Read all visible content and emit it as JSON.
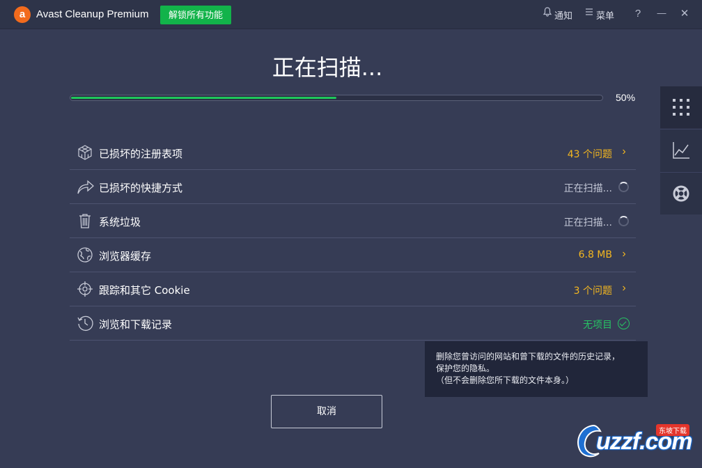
{
  "titlebar": {
    "app_title": "Avast Cleanup Premium",
    "logo_letter": "a",
    "unlock_label": "解锁所有功能",
    "notify_label": "通知",
    "menu_label": "菜单",
    "help_glyph": "?",
    "minimize_glyph": "—",
    "close_glyph": "✕"
  },
  "scan": {
    "title": "正在扫描...",
    "progress_value": 50,
    "progress_label": "50%"
  },
  "items": [
    {
      "label": "已损坏的注册表项",
      "status": "43 个问题",
      "state": "issue",
      "icon": "registry-cube-icon"
    },
    {
      "label": "已损坏的快捷方式",
      "status": "正在扫描...",
      "state": "scanning",
      "icon": "shortcut-arrow-icon"
    },
    {
      "label": "系统垃圾",
      "status": "正在扫描...",
      "state": "scanning",
      "icon": "trash-icon"
    },
    {
      "label": "浏览器缓存",
      "status": "6.8 MB",
      "state": "issue",
      "icon": "globe-icon"
    },
    {
      "label": "跟踪和其它 Cookie",
      "status": "3 个问题",
      "state": "issue",
      "icon": "crosshair-icon"
    },
    {
      "label": "浏览和下载记录",
      "status": "无项目",
      "state": "ok",
      "icon": "history-clock-icon"
    }
  ],
  "tooltip": {
    "line1": "删除您曾访问的网站和曾下载的文件的历史记录，",
    "line2": "保护您的隐私。",
    "line3": "（但不会删除您所下载的文件本身。）"
  },
  "cancel_label": "取消",
  "side_panel": [
    "grid-icon",
    "chart-icon",
    "lifebuoy-icon"
  ],
  "watermark": {
    "text": "uzzf.com",
    "tag": "东坡下载"
  },
  "colors": {
    "background": "#363c55",
    "titlebar": "#2e3449",
    "accent_green": "#12b34a",
    "issue_yellow": "#f4b71f",
    "ok_green": "#27c464",
    "logo_orange": "#f26b1d"
  }
}
